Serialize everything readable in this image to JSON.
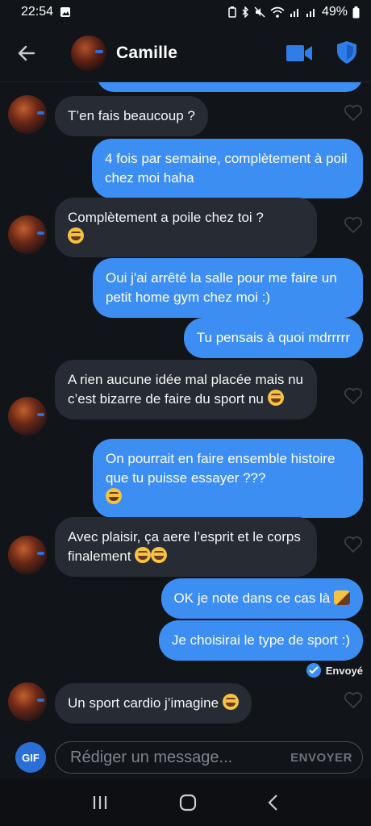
{
  "status_bar": {
    "time": "22:54",
    "battery": "49%"
  },
  "header": {
    "contact_name": "Camille"
  },
  "messages": {
    "m1": "T’en fais beaucoup ?",
    "m2": "4 fois par semaine, complètement à poil chez moi haha",
    "m3": "Complètement a poile chez toi ?",
    "m4": "Oui j'ai arrêté la salle pour me faire un petit home gym chez moi :)",
    "m5": "Tu pensais à quoi mdrrrrr",
    "m6": "A rien aucune idée mal placée mais nu c’est bizarre de faire du sport nu",
    "m7": "On pourrait en faire ensemble histoire que tu puisse essayer ???",
    "m8": "Avec plaisir, ça aere l’esprit et le corps finalement",
    "m9": "OK je note dans ce cas là",
    "m10": "Je choisirai le type de sport :)",
    "m11": "Un sport cardio j’imagine"
  },
  "sent_status": "Envoyé",
  "composer": {
    "gif_label": "GIF",
    "placeholder": "Rédiger un message...",
    "send_label": "ENVOYER"
  },
  "icons": {
    "back": "arrow-left-icon",
    "video": "video-camera-icon",
    "shield": "shield-icon",
    "heart": "heart-outline-icon",
    "nav_recent": "recent-apps-icon",
    "nav_home": "home-icon",
    "nav_back": "chevron-left-icon"
  },
  "colors": {
    "outgoing_bubble": "#3d8ef2",
    "incoming_bubble": "#272b33",
    "background": "#111418",
    "accent": "#2b6fd6"
  }
}
